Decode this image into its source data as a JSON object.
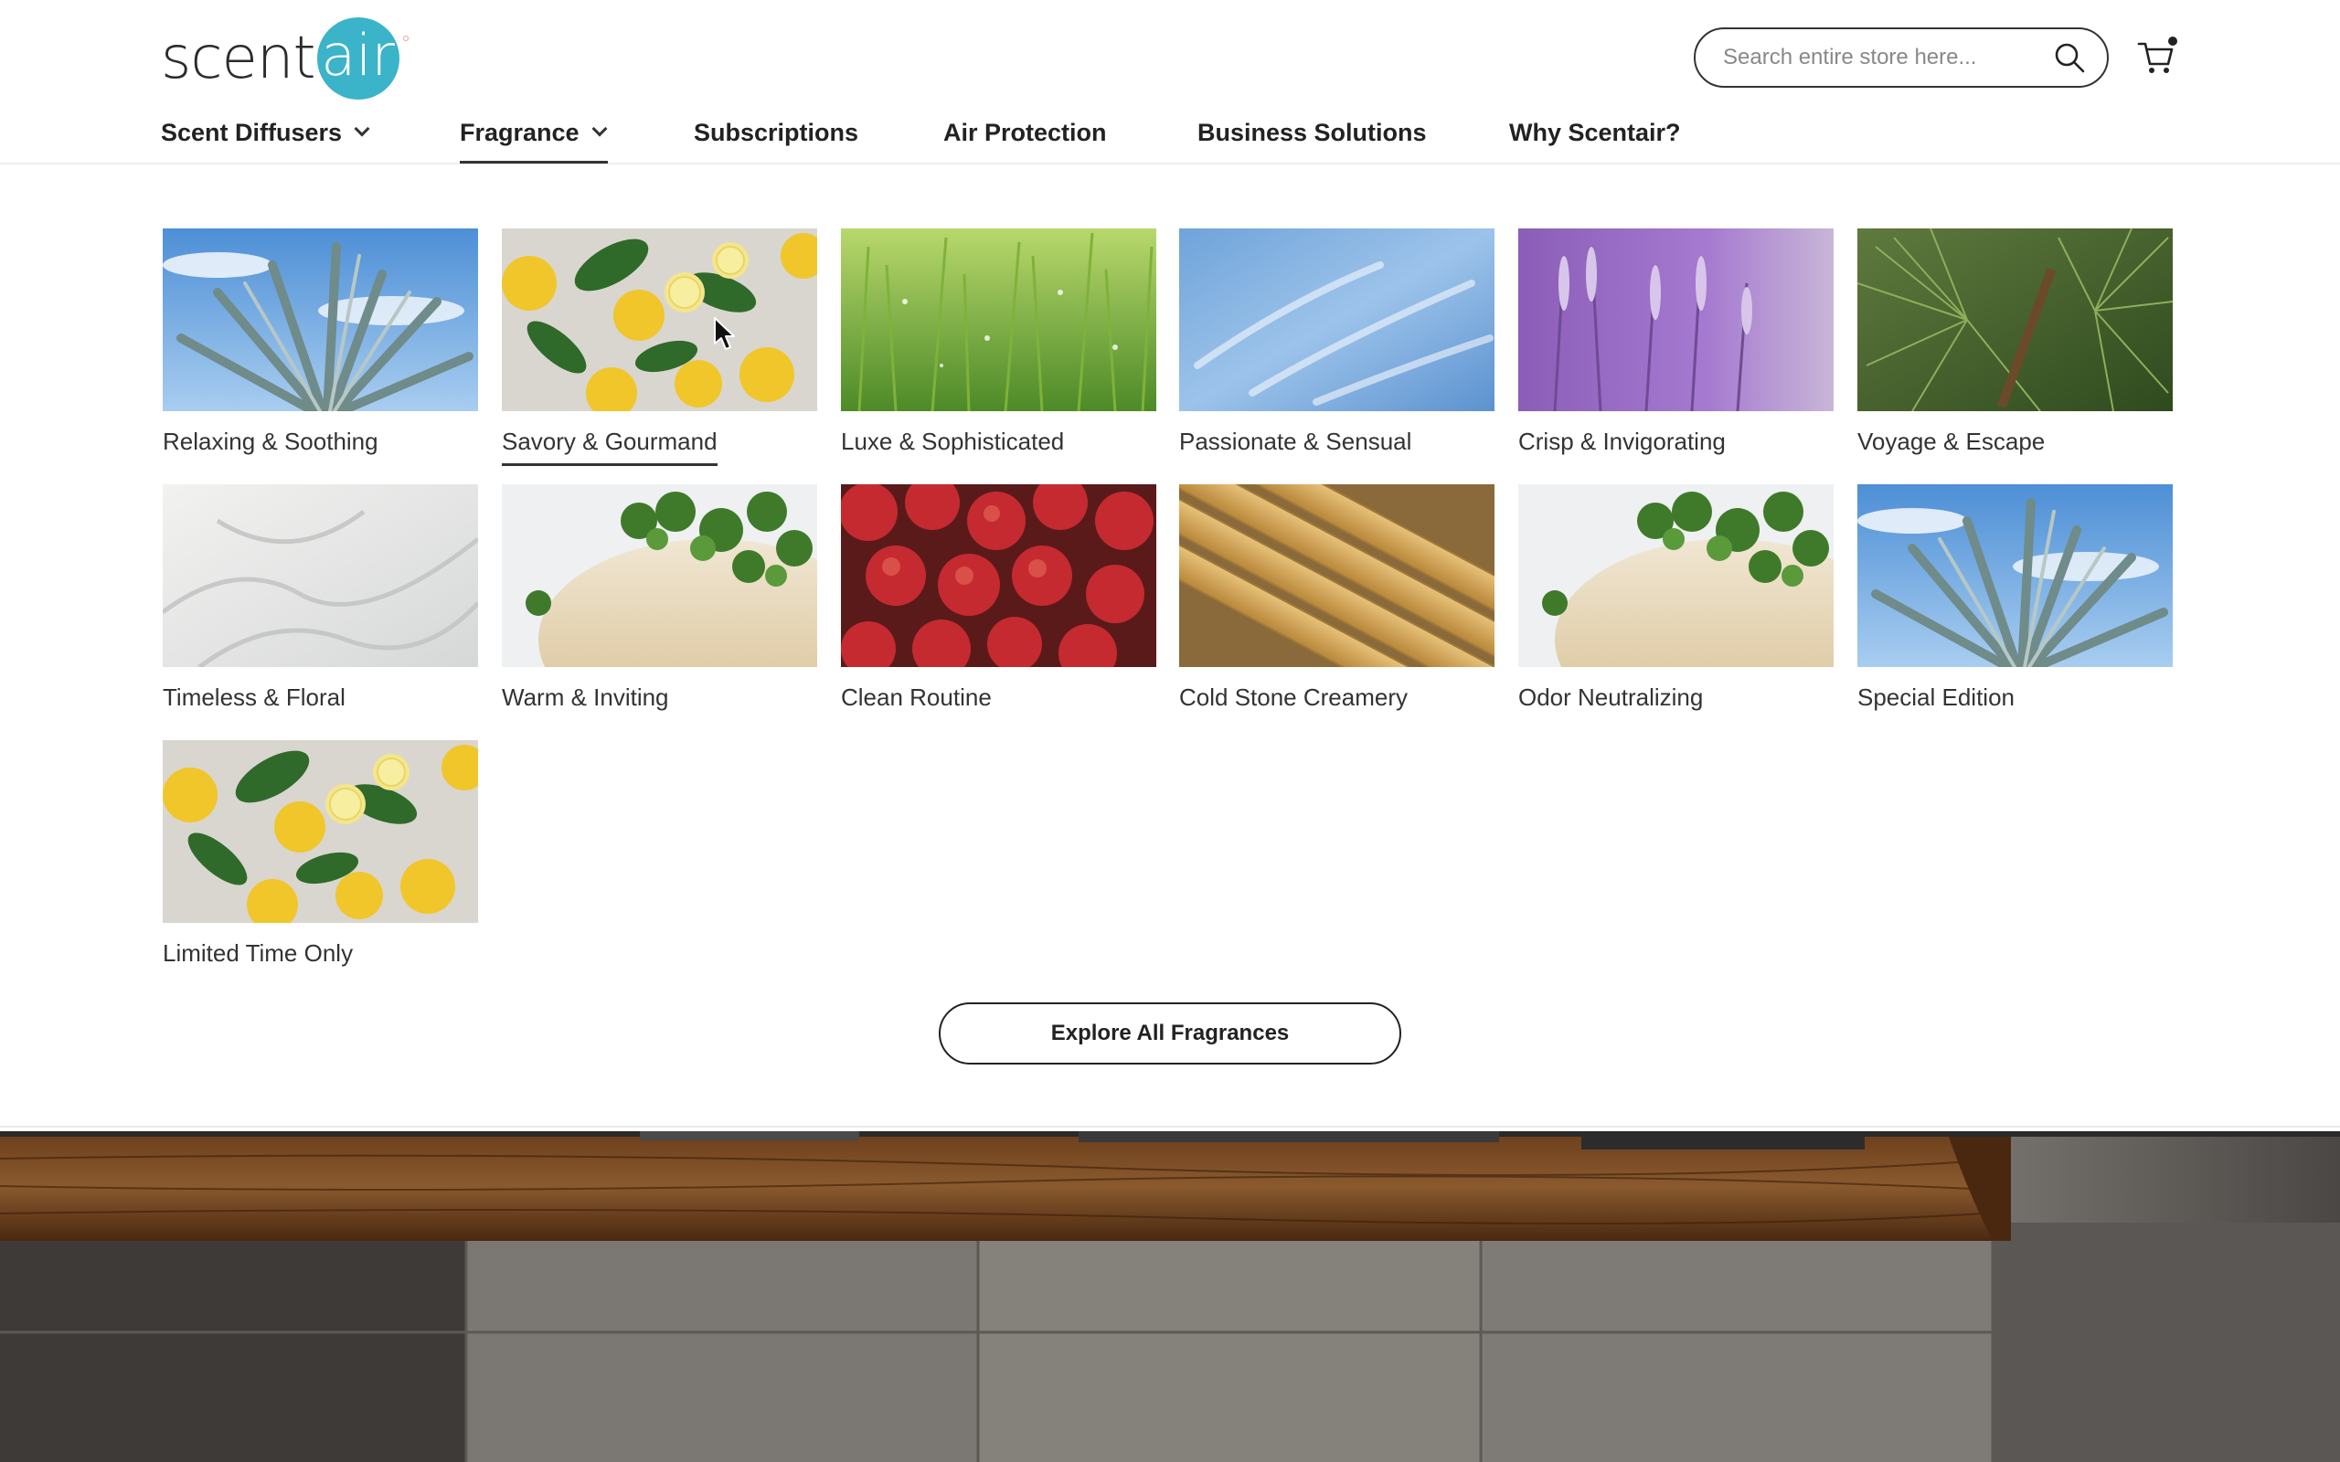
{
  "header": {
    "logo_text_left": "scent",
    "logo_text_right": "air",
    "search_placeholder": "Search entire store here...",
    "brand_color": "#3bb3c9"
  },
  "nav": {
    "items": [
      {
        "label": "Scent Diffusers",
        "has_dropdown": true
      },
      {
        "label": "Fragrance",
        "has_dropdown": true,
        "active": true
      },
      {
        "label": "Subscriptions",
        "has_dropdown": false
      },
      {
        "label": "Air Protection",
        "has_dropdown": false
      },
      {
        "label": "Business Solutions",
        "has_dropdown": false
      },
      {
        "label": "Why Scentair?",
        "has_dropdown": false
      }
    ]
  },
  "fragrance_menu": {
    "categories": [
      {
        "label": "Relaxing & Soothing",
        "image": "agave"
      },
      {
        "label": "Savory & Gourmand",
        "image": "lemons",
        "hovered": true
      },
      {
        "label": "Luxe & Sophisticated",
        "image": "grass"
      },
      {
        "label": "Passionate & Sensual",
        "image": "sky"
      },
      {
        "label": "Crisp & Invigorating",
        "image": "lavender"
      },
      {
        "label": "Voyage & Escape",
        "image": "pine"
      },
      {
        "label": "Timeless & Floral",
        "image": "linen"
      },
      {
        "label": "Warm & Inviting",
        "image": "thyme"
      },
      {
        "label": "Clean Routine",
        "image": "apples"
      },
      {
        "label": "Cold Stone Creamery",
        "image": "bamboo"
      },
      {
        "label": "Odor Neutralizing",
        "image": "thyme"
      },
      {
        "label": "Special Edition",
        "image": "agave"
      },
      {
        "label": "Limited Time Only",
        "image": "lemons"
      }
    ],
    "explore_label": "Explore All Fragrances"
  }
}
